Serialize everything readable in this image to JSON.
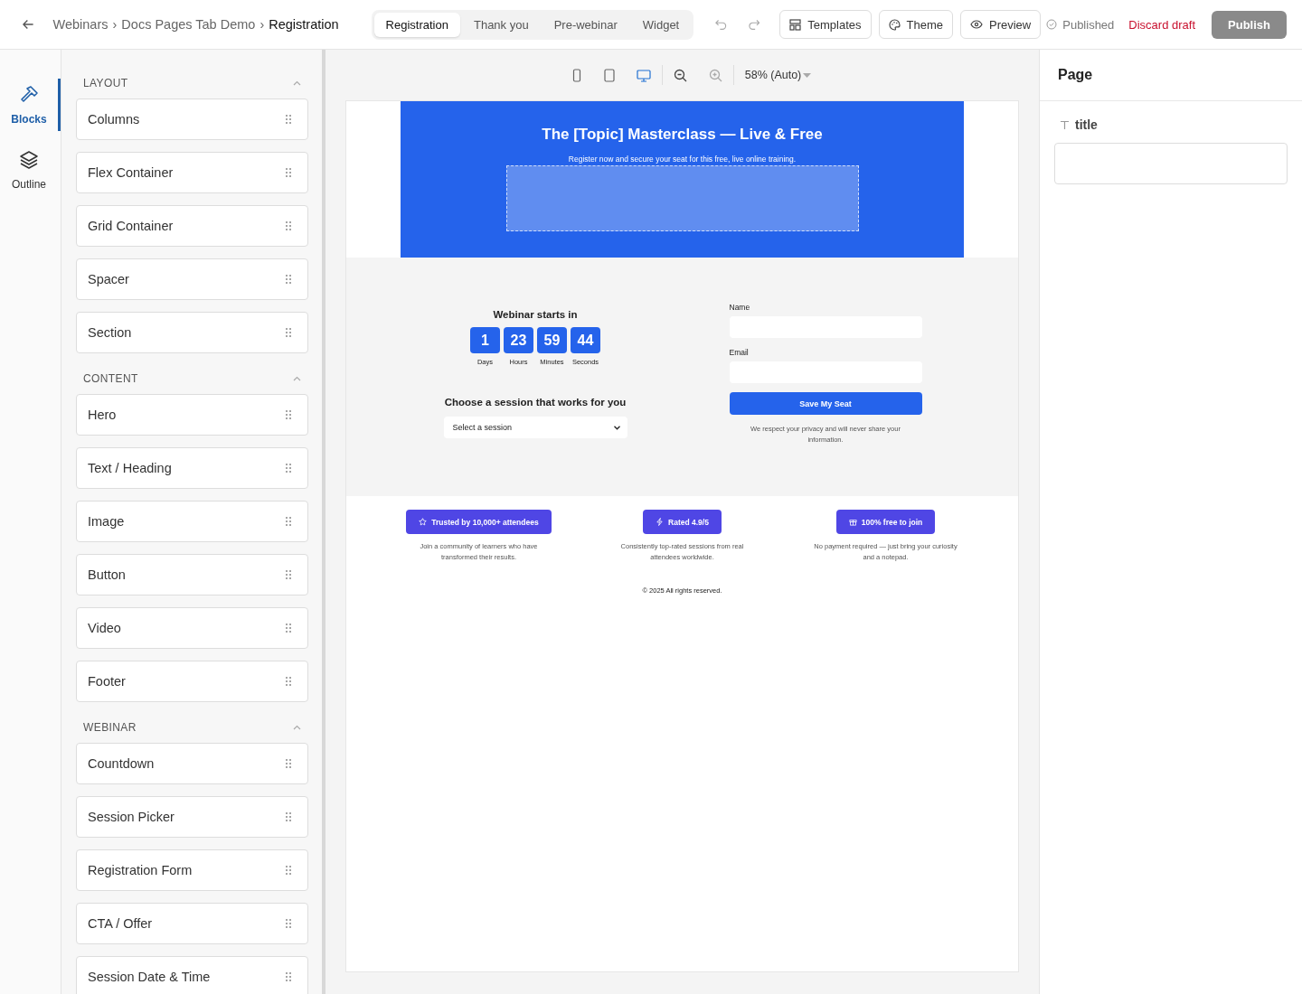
{
  "topbar": {
    "breadcrumb": [
      "Webinars",
      "Docs Pages Tab Demo",
      "Registration"
    ],
    "separator": "›",
    "tabs": [
      {
        "label": "Registration",
        "selected": true
      },
      {
        "label": "Thank you",
        "selected": false
      },
      {
        "label": "Pre-webinar",
        "selected": false
      },
      {
        "label": "Widget",
        "selected": false
      }
    ],
    "buttons": [
      {
        "label": "Templates",
        "kind": "templates"
      },
      {
        "label": "Theme",
        "kind": "theme"
      },
      {
        "label": "Preview",
        "kind": "preview"
      }
    ],
    "status": "Published",
    "discard": "Discard draft",
    "publish": "Publish"
  },
  "rail": [
    {
      "label": "Blocks",
      "kind": "blocks",
      "selected": true
    },
    {
      "label": "Outline",
      "kind": "outline",
      "selected": false
    }
  ],
  "blocks": [
    {
      "title": "LAYOUT",
      "expanded": true,
      "items": [
        "Columns",
        "Flex Container",
        "Grid Container",
        "Spacer",
        "Section"
      ]
    },
    {
      "title": "CONTENT",
      "expanded": true,
      "items": [
        "Hero",
        "Text / Heading",
        "Image",
        "Button",
        "Video",
        "Footer"
      ]
    },
    {
      "title": "WEBINAR",
      "expanded": true,
      "items": [
        "Countdown",
        "Session Picker",
        "Registration Form",
        "CTA / Offer",
        "Session Date & Time"
      ]
    }
  ],
  "canvas": {
    "devices": [
      {
        "kind": "phone",
        "selected": false
      },
      {
        "kind": "tablet",
        "selected": false
      },
      {
        "kind": "desktop",
        "selected": true
      }
    ],
    "zoom": "58% (Auto)",
    "hero": {
      "title": "The [Topic] Masterclass — Live & Free",
      "subtitle": "Register now and secure your seat for this free, live online training."
    },
    "countdown": {
      "title": "Webinar starts in",
      "units": [
        {
          "value": "1",
          "label": "Days"
        },
        {
          "value": "23",
          "label": "Hours"
        },
        {
          "value": "59",
          "label": "Minutes"
        },
        {
          "value": "44",
          "label": "Seconds"
        }
      ]
    },
    "session": {
      "title": "Choose a session that works for you",
      "placeholder": "Select a session"
    },
    "form": {
      "fields": [
        {
          "label": "Name"
        },
        {
          "label": "Email"
        }
      ],
      "submit": "Save My Seat",
      "note": "We respect your privacy and will never share your information."
    },
    "badges": [
      {
        "kind": "star",
        "label": "Trusted by 10,000+ attendees",
        "text": "Join a community of learners who have transformed their results."
      },
      {
        "kind": "bolt",
        "label": "Rated 4.9/5",
        "text": "Consistently top-rated sessions from real attendees worldwide."
      },
      {
        "kind": "gift",
        "label": "100% free to join",
        "text": "No payment required — just bring your curiosity and a notepad."
      }
    ],
    "footer": "© 2025 All rights reserved."
  },
  "inspector": {
    "title": "Page",
    "field_label": "title"
  }
}
